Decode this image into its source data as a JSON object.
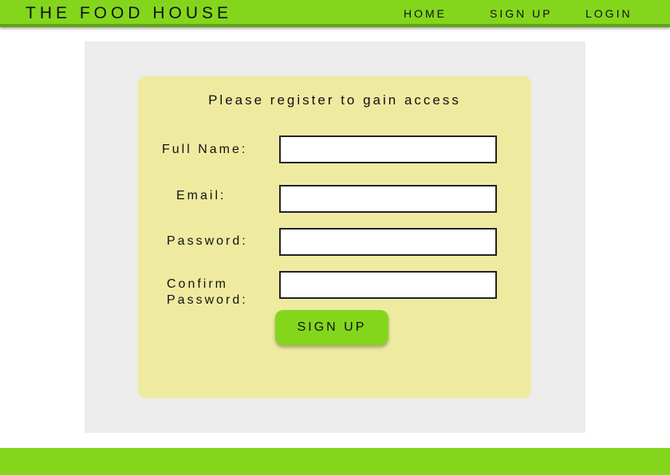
{
  "header": {
    "brand": "THE FOOD HOUSE",
    "nav": {
      "home": "HOME",
      "signup": "SIGN UP",
      "login": "LOGIN"
    }
  },
  "form": {
    "title": "Please register to gain access",
    "full_name_label": "Full Name:",
    "email_label": "Email:",
    "password_label": "Password:",
    "confirm_label_line1": "Confirm",
    "confirm_label_line2": "Password:",
    "full_name_value": "",
    "email_value": "",
    "password_value": "",
    "confirm_value": "",
    "submit_label": "SIGN UP"
  },
  "colors": {
    "accent_green": "#84d61d",
    "card_yellow": "#eeeba1",
    "panel_gray": "#ececec"
  }
}
